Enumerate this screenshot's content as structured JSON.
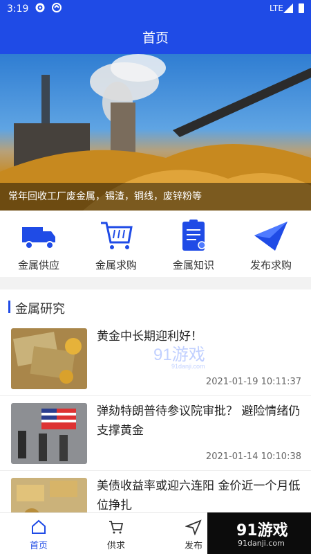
{
  "status_bar": {
    "time": "3:19",
    "network": "LTE",
    "icons": [
      "gear-icon",
      "sync-icon",
      "signal-icon",
      "battery-icon"
    ]
  },
  "header": {
    "title": "首页"
  },
  "banner": {
    "caption": "常年回收工厂废金属，锡渣，铜线，废锌粉等"
  },
  "quick_actions": [
    {
      "label": "金属供应",
      "icon": "truck-icon"
    },
    {
      "label": "金属求购",
      "icon": "cart-icon"
    },
    {
      "label": "金属知识",
      "icon": "clipboard-icon"
    },
    {
      "label": "发布求购",
      "icon": "paper-plane-icon"
    }
  ],
  "news_section": {
    "title": "金属研究",
    "items": [
      {
        "title": "黄金中长期迎利好！",
        "date": "2021-01-19 10:11:37"
      },
      {
        "title": "弹劾特朗普待参议院审批？ 避险情绪仍支撑黄金",
        "date": "2021-01-14 10:10:38"
      },
      {
        "title": "美债收益率或迎六连阳 金价近一个月低位挣扎",
        "date": ""
      }
    ]
  },
  "watermark": {
    "brand": "91游戏",
    "sub": "91danji.com"
  },
  "tab_bar": [
    {
      "label": "首页",
      "icon": "home-icon",
      "active": true
    },
    {
      "label": "供求",
      "icon": "cart-icon",
      "active": false
    },
    {
      "label": "发布",
      "icon": "send-icon",
      "active": false
    }
  ],
  "corner_logo": {
    "brand": "91游戏",
    "sub": "91danji.com"
  },
  "colors": {
    "primary": "#1f4be6",
    "text": "#222222",
    "muted": "#666666"
  }
}
